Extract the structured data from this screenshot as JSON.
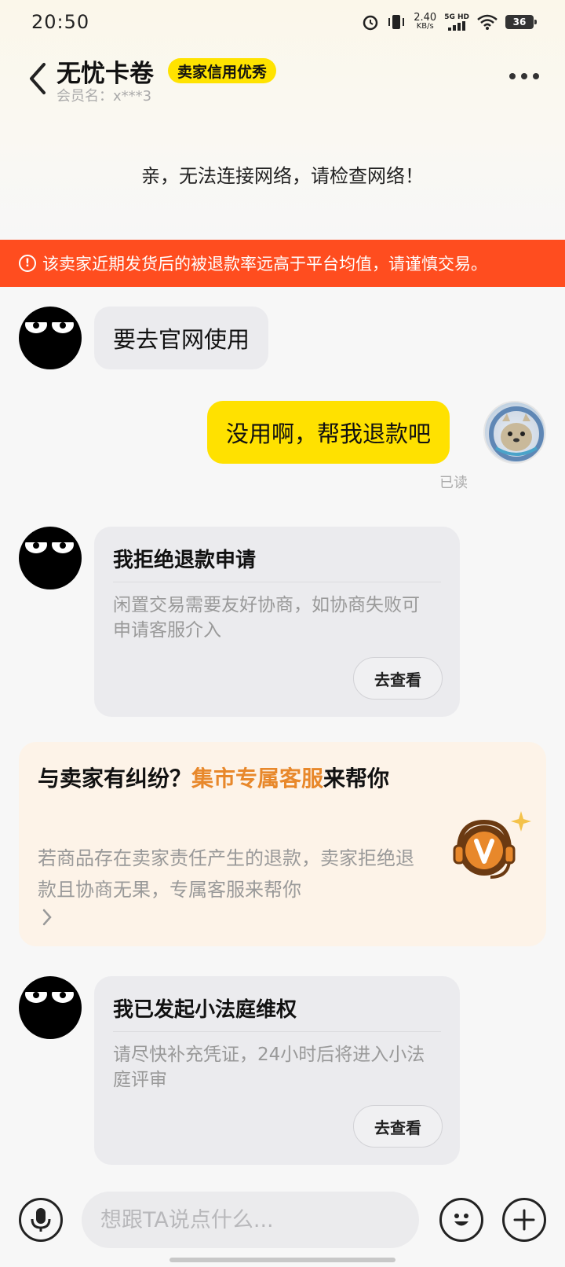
{
  "status_bar": {
    "time": "20:50",
    "speed_value": "2.40",
    "speed_unit": "KB/s",
    "network_label": "5G HD",
    "battery": "36"
  },
  "header": {
    "title": "无忧卡卷",
    "badge": "卖家信用优秀",
    "member": "会员名：x***3"
  },
  "network_error": "亲，无法连接网络，请检查网络！",
  "warning": {
    "icon": "!",
    "text": "该卖家近期发货后的被退款率远高于平台均值，请谨慎交易。"
  },
  "messages": {
    "m1": {
      "text": "要去官网使用"
    },
    "m2": {
      "text": "没用啊，帮我退款吧",
      "read": "已读"
    },
    "card1": {
      "title": "我拒绝退款申请",
      "desc": "闲置交易需要友好协商，如协商失败可申请客服介入",
      "button": "去查看"
    },
    "cs": {
      "title_pre": "与卖家有纠纷？",
      "title_hl": "集市专属客服",
      "title_post": "来帮你",
      "desc": "若商品存在卖家责任产生的退款，卖家拒绝退款且协商无果，专属客服来帮你",
      "accent": "#e8882b"
    },
    "card2": {
      "title": "我已发起小法庭维权",
      "desc": "请尽快补充凭证，24小时后将进入小法庭评审",
      "button": "去查看"
    }
  },
  "input_bar": {
    "placeholder": "想跟TA说点什么..."
  },
  "colors": {
    "warning_bg": "#ff4d1f",
    "yellow": "#ffe100",
    "badge_yellow": "#ffe300"
  }
}
